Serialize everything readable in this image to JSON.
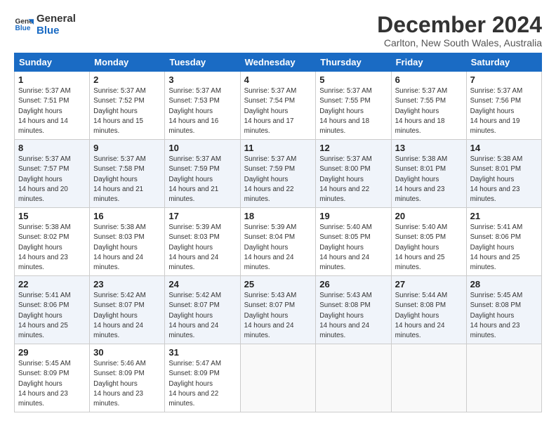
{
  "logo": {
    "line1": "General",
    "line2": "Blue"
  },
  "title": "December 2024",
  "location": "Carlton, New South Wales, Australia",
  "weekdays": [
    "Sunday",
    "Monday",
    "Tuesday",
    "Wednesday",
    "Thursday",
    "Friday",
    "Saturday"
  ],
  "weeks": [
    [
      {
        "day": "1",
        "rise": "5:37 AM",
        "set": "7:51 PM",
        "daylight": "14 hours and 14 minutes."
      },
      {
        "day": "2",
        "rise": "5:37 AM",
        "set": "7:52 PM",
        "daylight": "14 hours and 15 minutes."
      },
      {
        "day": "3",
        "rise": "5:37 AM",
        "set": "7:53 PM",
        "daylight": "14 hours and 16 minutes."
      },
      {
        "day": "4",
        "rise": "5:37 AM",
        "set": "7:54 PM",
        "daylight": "14 hours and 17 minutes."
      },
      {
        "day": "5",
        "rise": "5:37 AM",
        "set": "7:55 PM",
        "daylight": "14 hours and 18 minutes."
      },
      {
        "day": "6",
        "rise": "5:37 AM",
        "set": "7:55 PM",
        "daylight": "14 hours and 18 minutes."
      },
      {
        "day": "7",
        "rise": "5:37 AM",
        "set": "7:56 PM",
        "daylight": "14 hours and 19 minutes."
      }
    ],
    [
      {
        "day": "8",
        "rise": "5:37 AM",
        "set": "7:57 PM",
        "daylight": "14 hours and 20 minutes."
      },
      {
        "day": "9",
        "rise": "5:37 AM",
        "set": "7:58 PM",
        "daylight": "14 hours and 21 minutes."
      },
      {
        "day": "10",
        "rise": "5:37 AM",
        "set": "7:59 PM",
        "daylight": "14 hours and 21 minutes."
      },
      {
        "day": "11",
        "rise": "5:37 AM",
        "set": "7:59 PM",
        "daylight": "14 hours and 22 minutes."
      },
      {
        "day": "12",
        "rise": "5:37 AM",
        "set": "8:00 PM",
        "daylight": "14 hours and 22 minutes."
      },
      {
        "day": "13",
        "rise": "5:38 AM",
        "set": "8:01 PM",
        "daylight": "14 hours and 23 minutes."
      },
      {
        "day": "14",
        "rise": "5:38 AM",
        "set": "8:01 PM",
        "daylight": "14 hours and 23 minutes."
      }
    ],
    [
      {
        "day": "15",
        "rise": "5:38 AM",
        "set": "8:02 PM",
        "daylight": "14 hours and 23 minutes."
      },
      {
        "day": "16",
        "rise": "5:38 AM",
        "set": "8:03 PM",
        "daylight": "14 hours and 24 minutes."
      },
      {
        "day": "17",
        "rise": "5:39 AM",
        "set": "8:03 PM",
        "daylight": "14 hours and 24 minutes."
      },
      {
        "day": "18",
        "rise": "5:39 AM",
        "set": "8:04 PM",
        "daylight": "14 hours and 24 minutes."
      },
      {
        "day": "19",
        "rise": "5:40 AM",
        "set": "8:05 PM",
        "daylight": "14 hours and 24 minutes."
      },
      {
        "day": "20",
        "rise": "5:40 AM",
        "set": "8:05 PM",
        "daylight": "14 hours and 25 minutes."
      },
      {
        "day": "21",
        "rise": "5:41 AM",
        "set": "8:06 PM",
        "daylight": "14 hours and 25 minutes."
      }
    ],
    [
      {
        "day": "22",
        "rise": "5:41 AM",
        "set": "8:06 PM",
        "daylight": "14 hours and 25 minutes."
      },
      {
        "day": "23",
        "rise": "5:42 AM",
        "set": "8:07 PM",
        "daylight": "14 hours and 24 minutes."
      },
      {
        "day": "24",
        "rise": "5:42 AM",
        "set": "8:07 PM",
        "daylight": "14 hours and 24 minutes."
      },
      {
        "day": "25",
        "rise": "5:43 AM",
        "set": "8:07 PM",
        "daylight": "14 hours and 24 minutes."
      },
      {
        "day": "26",
        "rise": "5:43 AM",
        "set": "8:08 PM",
        "daylight": "14 hours and 24 minutes."
      },
      {
        "day": "27",
        "rise": "5:44 AM",
        "set": "8:08 PM",
        "daylight": "14 hours and 24 minutes."
      },
      {
        "day": "28",
        "rise": "5:45 AM",
        "set": "8:08 PM",
        "daylight": "14 hours and 23 minutes."
      }
    ],
    [
      {
        "day": "29",
        "rise": "5:45 AM",
        "set": "8:09 PM",
        "daylight": "14 hours and 23 minutes."
      },
      {
        "day": "30",
        "rise": "5:46 AM",
        "set": "8:09 PM",
        "daylight": "14 hours and 23 minutes."
      },
      {
        "day": "31",
        "rise": "5:47 AM",
        "set": "8:09 PM",
        "daylight": "14 hours and 22 minutes."
      },
      null,
      null,
      null,
      null
    ]
  ]
}
